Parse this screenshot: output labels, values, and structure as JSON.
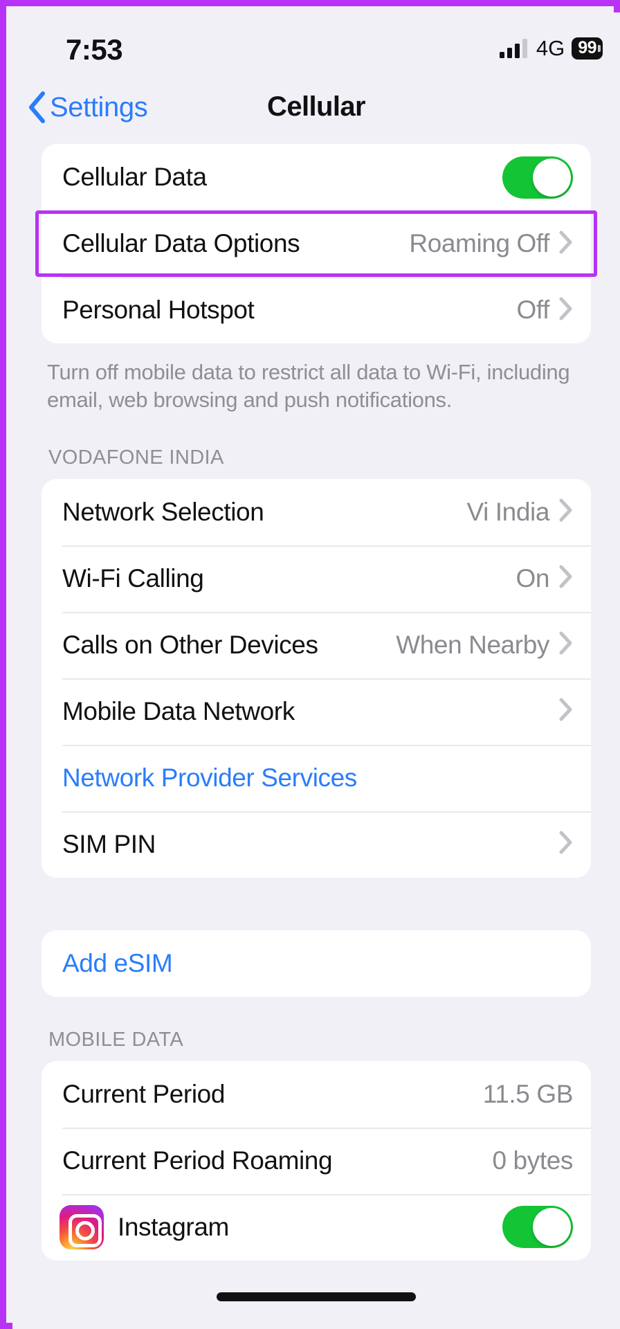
{
  "status_bar": {
    "time": "7:53",
    "network_type": "4G",
    "battery_level": "99",
    "signal_icon": "cellular-signal-icon",
    "battery_icon": "battery-icon"
  },
  "nav": {
    "back_label": "Settings",
    "back_icon": "chevron-left-icon",
    "title": "Cellular"
  },
  "section_data": {
    "rows": [
      {
        "label": "Cellular Data",
        "value": "",
        "control": "toggle",
        "toggle_on": true
      },
      {
        "label": "Cellular Data Options",
        "value": "Roaming Off",
        "control": "chevron",
        "highlighted": true
      },
      {
        "label": "Personal Hotspot",
        "value": "Off",
        "control": "chevron"
      }
    ],
    "footnote": "Turn off mobile data to restrict all data to Wi-Fi, including email, web browsing and push notifications."
  },
  "section_carrier": {
    "header": "VODAFONE INDIA",
    "rows": [
      {
        "label": "Network Selection",
        "value": "Vi India",
        "control": "chevron"
      },
      {
        "label": "Wi-Fi Calling",
        "value": "On",
        "control": "chevron"
      },
      {
        "label": "Calls on Other Devices",
        "value": "When Nearby",
        "control": "chevron"
      },
      {
        "label": "Mobile Data Network",
        "value": "",
        "control": "chevron"
      },
      {
        "label": "Network Provider Services",
        "value": "",
        "control": "none",
        "link": true
      },
      {
        "label": "SIM PIN",
        "value": "",
        "control": "chevron"
      }
    ]
  },
  "section_esim": {
    "rows": [
      {
        "label": "Add eSIM",
        "value": "",
        "control": "none",
        "link": true
      }
    ]
  },
  "section_mobile_data": {
    "header": "MOBILE DATA",
    "rows": [
      {
        "label": "Current Period",
        "value": "11.5 GB",
        "control": "none"
      },
      {
        "label": "Current Period Roaming",
        "value": "0 bytes",
        "control": "none"
      }
    ],
    "apps": [
      {
        "name": "Instagram",
        "icon": "instagram-icon",
        "toggle_on": true
      }
    ]
  },
  "colors": {
    "accent_link": "#2a7dfb",
    "toggle_on": "#13c434",
    "highlight": "#b833f5",
    "page_bg": "#f2f0f7",
    "card_bg": "#ffffff",
    "value_text": "#8a8a90"
  }
}
